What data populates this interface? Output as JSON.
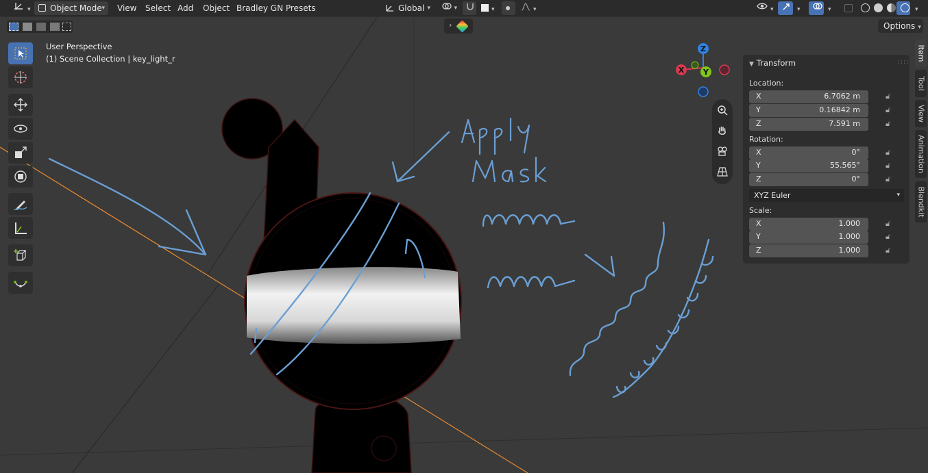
{
  "header": {
    "editor_type_icon": "axes-editor-icon",
    "mode_label": "Object Mode",
    "menus": [
      "View",
      "Select",
      "Add",
      "Object",
      "Bradley GN Presets"
    ],
    "transform_orientation": "Global",
    "options_label": "Options"
  },
  "viewport": {
    "perspective_label": "User Perspective",
    "collection_label": "(1) Scene Collection | key_light_r"
  },
  "annotations": {
    "line1": "Apply",
    "line2": "Mask"
  },
  "gizmo": {
    "z": "Z",
    "y": "Y",
    "x": "X"
  },
  "npanel": {
    "title": "Transform",
    "location_label": "Location:",
    "location": [
      {
        "axis": "X",
        "value": "6.7062 m"
      },
      {
        "axis": "Y",
        "value": "0.16842 m"
      },
      {
        "axis": "Z",
        "value": "7.591 m"
      }
    ],
    "rotation_label": "Rotation:",
    "rotation": [
      {
        "axis": "X",
        "value": "0°"
      },
      {
        "axis": "Y",
        "value": "55.565°"
      },
      {
        "axis": "Z",
        "value": "0°"
      }
    ],
    "rotation_mode": "XYZ Euler",
    "scale_label": "Scale:",
    "scale": [
      {
        "axis": "X",
        "value": "1.000"
      },
      {
        "axis": "Y",
        "value": "1.000"
      },
      {
        "axis": "Z",
        "value": "1.000"
      }
    ]
  },
  "sidetabs": [
    "Item",
    "Tool",
    "View",
    "Animation",
    "Blendkit"
  ],
  "colors": {
    "accent": "#4772b3",
    "annotation": "#6a9fd4",
    "axis_x": "#d7394f",
    "axis_y": "#7ec51d",
    "axis_z": "#2f83e3",
    "orange_line": "#e88a2e"
  }
}
